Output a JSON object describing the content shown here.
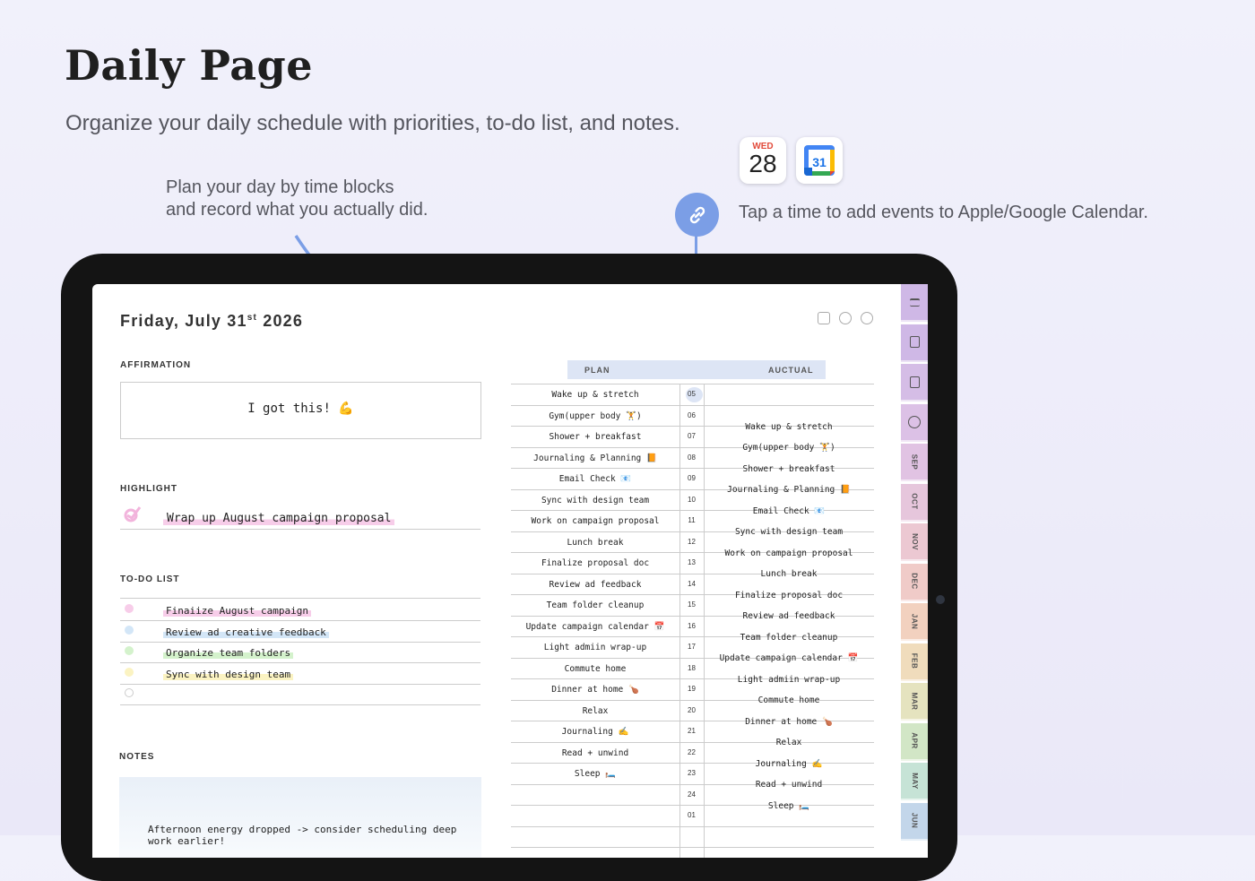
{
  "header": {
    "title": "Daily Page",
    "subtitle": "Organize your daily schedule with priorities, to-do list, and notes."
  },
  "callouts": {
    "left_line1": "Plan your day by time blocks",
    "left_line2": "and record what you actually did.",
    "right": "Tap a time to add events to Apple/Google Calendar."
  },
  "calendar_icons": {
    "apple_dow": "WED",
    "apple_day": "28",
    "google_day": "31"
  },
  "planner": {
    "date_main": "Friday, July 31",
    "date_suffix": "st",
    "date_year": " 2026",
    "affirmation_label": "AFFIRMATION",
    "affirmation_text": "I got this! 💪",
    "highlight_label": "HIGHLIGHT",
    "highlight_text": "Wrap up August campaign proposal",
    "todo_label": "TO-DO LIST",
    "todos": [
      {
        "text": "Finaiize August campaign",
        "color": "#f7cde9"
      },
      {
        "text": "Review ad creative feedback",
        "color": "#d3e6f7"
      },
      {
        "text": "Organize team folders",
        "color": "#d4f2cc"
      },
      {
        "text": "Sync with design team",
        "color": "#fbf3c2"
      },
      {
        "text": "",
        "color": ""
      }
    ],
    "notes_label": "NOTES",
    "notes_text": "Afternoon energy dropped -> consider scheduling deep work earlier!",
    "plan_label": "PLAN",
    "actual_label": "AUCTUAL",
    "schedule": [
      {
        "plan": "Wake up & stretch",
        "hour": "05",
        "actual": ""
      },
      {
        "plan": "Gym(upper body 🏋️)",
        "hour": "06",
        "actual": "Wake up & stretch"
      },
      {
        "plan": "Shower + breakfast",
        "hour": "07",
        "actual": "Gym(upper body 🏋️)"
      },
      {
        "plan": "Journaling & Planning 📙",
        "hour": "08",
        "actual": "Shower + breakfast"
      },
      {
        "plan": "Email Check 📧",
        "hour": "09",
        "actual": "Journaling & Planning 📙"
      },
      {
        "plan": "Sync with design team",
        "hour": "10",
        "actual": "Email Check 📧"
      },
      {
        "plan": "Work on campaign proposal",
        "hour": "11",
        "actual": "Sync with design team"
      },
      {
        "plan": "Lunch break",
        "hour": "12",
        "actual": "Work on campaign proposal"
      },
      {
        "plan": "Finalize proposal doc",
        "hour": "13",
        "actual": "Lunch break"
      },
      {
        "plan": "Review ad feedback",
        "hour": "14",
        "actual": "Finalize proposal doc"
      },
      {
        "plan": "Team folder cleanup",
        "hour": "15",
        "actual": "Review ad feedback"
      },
      {
        "plan": "Update campaign calendar 📅",
        "hour": "16",
        "actual": "Team folder cleanup"
      },
      {
        "plan": "Light admiin wrap-up",
        "hour": "17",
        "actual": "Update campaign calendar 📅"
      },
      {
        "plan": "Commute home",
        "hour": "18",
        "actual": "Light admiin wrap-up"
      },
      {
        "plan": "Dinner at home 🍗",
        "hour": "19",
        "actual": "Commute home"
      },
      {
        "plan": "Relax",
        "hour": "20",
        "actual": "Dinner at home 🍗"
      },
      {
        "plan": "Journaling ✍️",
        "hour": "21",
        "actual": "Relax"
      },
      {
        "plan": "Read + unwind",
        "hour": "22",
        "actual": "Journaling ✍️"
      },
      {
        "plan": "Sleep 🛏️",
        "hour": "23",
        "actual": "Read + unwind"
      },
      {
        "plan": "",
        "hour": "24",
        "actual": "Sleep 🛏️"
      },
      {
        "plan": "",
        "hour": "01",
        "actual": ""
      },
      {
        "plan": "",
        "hour": "",
        "actual": ""
      }
    ],
    "tabs": [
      {
        "label": "",
        "icon": "menu-icon",
        "color": "#cfb8e6"
      },
      {
        "label": "",
        "icon": "notebook-icon",
        "color": "#cfb8e6"
      },
      {
        "label": "",
        "icon": "document-icon",
        "color": "#d5bde6"
      },
      {
        "label": "",
        "icon": "star-icon",
        "color": "#dcc1e6"
      },
      {
        "label": "SEP",
        "icon": "",
        "color": "#e1c3e3"
      },
      {
        "label": "OCT",
        "icon": "",
        "color": "#e6c6dc"
      },
      {
        "label": "NOV",
        "icon": "",
        "color": "#ecc8d2"
      },
      {
        "label": "DEC",
        "icon": "",
        "color": "#f0cbc8"
      },
      {
        "label": "JAN",
        "icon": "",
        "color": "#f2d1bf"
      },
      {
        "label": "FEB",
        "icon": "",
        "color": "#f0dcbc"
      },
      {
        "label": "MAR",
        "icon": "",
        "color": "#e5e3bf"
      },
      {
        "label": "APR",
        "icon": "",
        "color": "#d2e6c6"
      },
      {
        "label": "MAY",
        "icon": "",
        "color": "#c6e3d6"
      },
      {
        "label": "JUN",
        "icon": "",
        "color": "#c3d6ea"
      }
    ]
  }
}
